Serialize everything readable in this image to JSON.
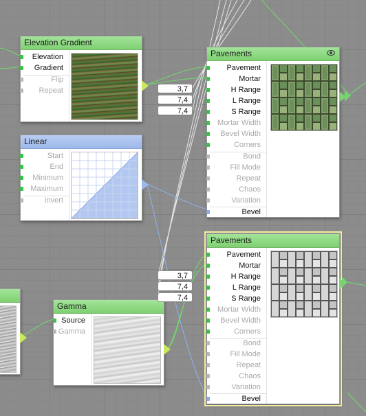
{
  "nodes": {
    "elevation_gradient": {
      "title": "Elevation Gradient",
      "inputs": [
        {
          "label": "Elevation",
          "state": "on"
        },
        {
          "label": "Gradient",
          "state": "on"
        },
        {
          "label": "Flip",
          "state": "off"
        },
        {
          "label": "Repeat",
          "state": "off"
        }
      ]
    },
    "linear": {
      "title": "Linear",
      "inputs": [
        {
          "label": "Start",
          "state": "off"
        },
        {
          "label": "End",
          "state": "off"
        },
        {
          "label": "Minimum",
          "state": "off"
        },
        {
          "label": "Maximum",
          "state": "off"
        },
        {
          "label": "Invert",
          "state": "off"
        }
      ]
    },
    "gamma": {
      "title": "Gamma",
      "inputs": [
        {
          "label": "Source",
          "state": "on"
        },
        {
          "label": "Gamma",
          "state": "off"
        }
      ]
    },
    "pavements_top": {
      "title": "Pavements",
      "inputs": [
        {
          "label": "Pavement",
          "state": "on"
        },
        {
          "label": "Mortar",
          "state": "on"
        },
        {
          "label": "H Range",
          "state": "on"
        },
        {
          "label": "L Range",
          "state": "on"
        },
        {
          "label": "S Range",
          "state": "on"
        },
        {
          "label": "Mortar Width",
          "state": "off"
        },
        {
          "label": "Bevel Width",
          "state": "off"
        },
        {
          "label": "Corners",
          "state": "off"
        },
        {
          "label": "Bond",
          "state": "off"
        },
        {
          "label": "Fill Mode",
          "state": "off"
        },
        {
          "label": "Repeat",
          "state": "off"
        },
        {
          "label": "Chaos",
          "state": "off"
        },
        {
          "label": "Variation",
          "state": "off"
        },
        {
          "label": "Bevel",
          "state": "on"
        }
      ],
      "values": [
        "3,7",
        "7,4",
        "7,4"
      ]
    },
    "pavements_bottom": {
      "title": "Pavements",
      "inputs": [
        {
          "label": "Pavement",
          "state": "on"
        },
        {
          "label": "Mortar",
          "state": "on"
        },
        {
          "label": "H Range",
          "state": "on"
        },
        {
          "label": "L Range",
          "state": "on"
        },
        {
          "label": "S Range",
          "state": "on"
        },
        {
          "label": "Mortar Width",
          "state": "off"
        },
        {
          "label": "Bevel Width",
          "state": "off"
        },
        {
          "label": "Corners",
          "state": "off"
        },
        {
          "label": "Bond",
          "state": "off"
        },
        {
          "label": "Fill Mode",
          "state": "off"
        },
        {
          "label": "Repeat",
          "state": "off"
        },
        {
          "label": "Chaos",
          "state": "off"
        },
        {
          "label": "Variation",
          "state": "off"
        },
        {
          "label": "Bevel",
          "state": "on"
        }
      ],
      "values": [
        "3,7",
        "7,4",
        "7,4"
      ]
    }
  },
  "colors": {
    "canvas": "#8c8c8c",
    "header_green": "#8fda82",
    "header_blue": "#a9c2ee",
    "port_green": "#39c24a",
    "port_blue": "#8fa9e6",
    "wire_green": "#6fdc6a",
    "wire_blue": "#8fb1f0",
    "wire_white": "#e8e8e8",
    "selection": "#f4eda0"
  }
}
